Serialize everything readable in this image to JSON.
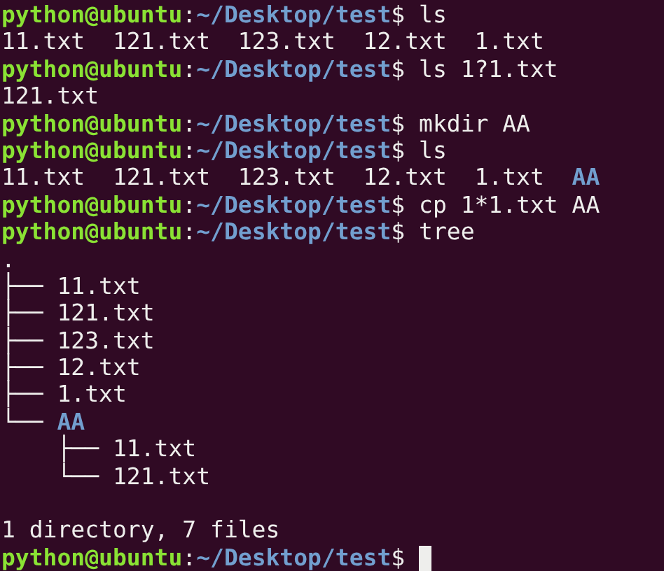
{
  "terminal": {
    "lines": [
      {
        "kind": "prompt",
        "user_host": "python@ubuntu",
        "separator": ":",
        "path": "~/Desktop/test",
        "symbol": "$",
        "command": "ls",
        "cursor": false
      },
      {
        "kind": "listing",
        "entries": [
          {
            "name": "11.txt",
            "kind": "file"
          },
          {
            "name": "121.txt",
            "kind": "file"
          },
          {
            "name": "123.txt",
            "kind": "file"
          },
          {
            "name": "12.txt",
            "kind": "file"
          },
          {
            "name": "1.txt",
            "kind": "file"
          }
        ]
      },
      {
        "kind": "prompt",
        "user_host": "python@ubuntu",
        "separator": ":",
        "path": "~/Desktop/test",
        "symbol": "$",
        "command": "ls 1?1.txt",
        "cursor": false
      },
      {
        "kind": "listing",
        "entries": [
          {
            "name": "121.txt",
            "kind": "file"
          }
        ]
      },
      {
        "kind": "prompt",
        "user_host": "python@ubuntu",
        "separator": ":",
        "path": "~/Desktop/test",
        "symbol": "$",
        "command": "mkdir AA",
        "cursor": false
      },
      {
        "kind": "prompt",
        "user_host": "python@ubuntu",
        "separator": ":",
        "path": "~/Desktop/test",
        "symbol": "$",
        "command": "ls",
        "cursor": false
      },
      {
        "kind": "listing",
        "entries": [
          {
            "name": "11.txt",
            "kind": "file"
          },
          {
            "name": "121.txt",
            "kind": "file"
          },
          {
            "name": "123.txt",
            "kind": "file"
          },
          {
            "name": "12.txt",
            "kind": "file"
          },
          {
            "name": "1.txt",
            "kind": "file"
          },
          {
            "name": "AA",
            "kind": "dir"
          }
        ]
      },
      {
        "kind": "prompt",
        "user_host": "python@ubuntu",
        "separator": ":",
        "path": "~/Desktop/test",
        "symbol": "$",
        "command": "cp 1*1.txt AA",
        "cursor": false
      },
      {
        "kind": "prompt",
        "user_host": "python@ubuntu",
        "separator": ":",
        "path": "~/Desktop/test",
        "symbol": "$",
        "command": "tree",
        "cursor": false
      },
      {
        "kind": "tree",
        "root": ".",
        "children": [
          {
            "branch": "├──",
            "name": "11.txt",
            "kind": "file"
          },
          {
            "branch": "├──",
            "name": "121.txt",
            "kind": "file"
          },
          {
            "branch": "├──",
            "name": "123.txt",
            "kind": "file"
          },
          {
            "branch": "├──",
            "name": "12.txt",
            "kind": "file"
          },
          {
            "branch": "├──",
            "name": "1.txt",
            "kind": "file"
          },
          {
            "branch": "└──",
            "name": "AA",
            "kind": "dir",
            "children": [
              {
                "branch": "├──",
                "name": "11.txt",
                "kind": "file"
              },
              {
                "branch": "└──",
                "name": "121.txt",
                "kind": "file"
              }
            ]
          }
        ]
      },
      {
        "kind": "blank"
      },
      {
        "kind": "text",
        "text": "1 directory, 7 files"
      },
      {
        "kind": "prompt",
        "user_host": "python@ubuntu",
        "separator": ":",
        "path": "~/Desktop/test",
        "symbol": "$",
        "cursor": true
      }
    ]
  }
}
